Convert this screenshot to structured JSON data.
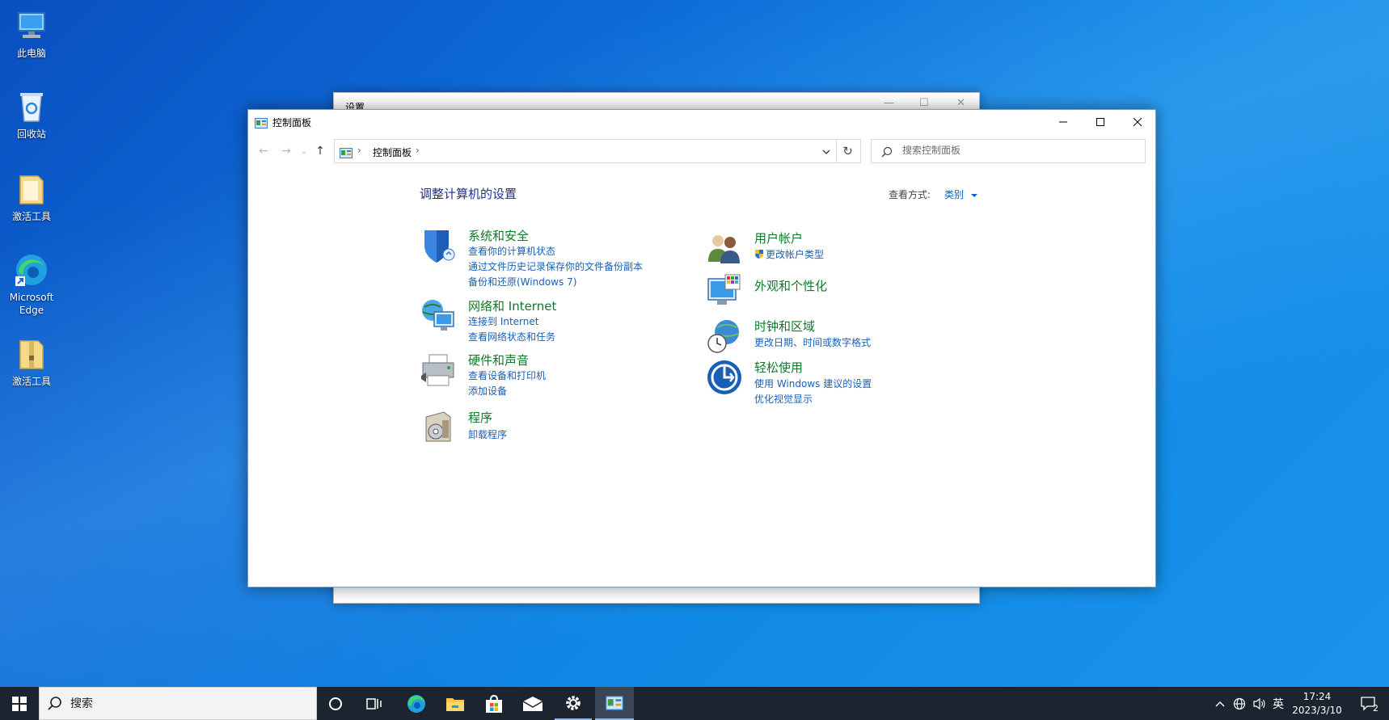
{
  "desktop": {
    "icons": [
      {
        "label": "此电脑",
        "icon": "computer-icon"
      },
      {
        "label": "回收站",
        "icon": "recycle-bin-icon"
      },
      {
        "label": "激活工具",
        "icon": "folder-icon"
      },
      {
        "label": "Microsoft Edge",
        "icon": "edge-icon"
      },
      {
        "label": "激活工具",
        "icon": "zip-folder-icon"
      }
    ]
  },
  "background_window": {
    "title": "设置"
  },
  "window": {
    "title": "控制面板",
    "address": {
      "crumb": "控制面板"
    },
    "search_placeholder": "搜索控制面板",
    "heading": "调整计算机的设置",
    "view_by_label": "查看方式:",
    "view_by_value": "类别",
    "categories_left": [
      {
        "title": "系统和安全",
        "icon": "shield-icon",
        "links": [
          "查看你的计算机状态",
          "通过文件历史记录保存你的文件备份副本",
          "备份和还原(Windows 7)"
        ]
      },
      {
        "title": "网络和 Internet",
        "icon": "network-globe-icon",
        "links": [
          "连接到 Internet",
          "查看网络状态和任务"
        ]
      },
      {
        "title": "硬件和声音",
        "icon": "printer-icon",
        "links": [
          "查看设备和打印机",
          "添加设备"
        ]
      },
      {
        "title": "程序",
        "icon": "programs-disc-icon",
        "links": [
          "卸载程序"
        ]
      }
    ],
    "categories_right": [
      {
        "title": "用户帐户",
        "icon": "users-icon",
        "links": [
          "更改帐户类型"
        ]
      },
      {
        "title": "外观和个性化",
        "icon": "monitor-palette-icon",
        "links": []
      },
      {
        "title": "时钟和区域",
        "icon": "clock-globe-icon",
        "links": [
          "更改日期、时间或数字格式"
        ]
      },
      {
        "title": "轻松使用",
        "icon": "ease-of-access-icon",
        "links": [
          "使用 Windows 建议的设置",
          "优化视觉显示"
        ]
      }
    ]
  },
  "taskbar": {
    "search_placeholder": "搜索",
    "ime": "英",
    "time": "17:24",
    "date": "2023/3/10",
    "notification_count": "2"
  },
  "colors": {
    "category_title": "#0d7a2a",
    "link": "#1a5fb4",
    "heading": "#1e3287",
    "taskbar": "#1c2430"
  }
}
